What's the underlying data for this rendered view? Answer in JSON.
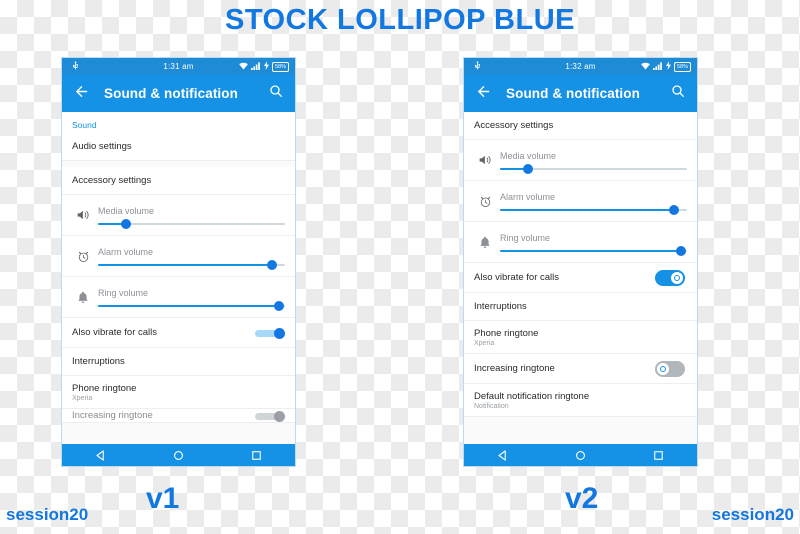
{
  "title": "STOCK LOLLIPOP BLUE",
  "colors": {
    "accent": "#1277e0",
    "appbar": "#1592e6",
    "statusbar": "#1e8bd6",
    "toggle_off": "#b0b6ba"
  },
  "captions": {
    "session_left": "session20",
    "session_right": "session20",
    "v1": "v1",
    "v2": "v2"
  },
  "phones": [
    {
      "id": "v1",
      "statusbar": {
        "time": "1:31 am",
        "battery": "58%",
        "usb_icon": "usb-icon",
        "wifi_icon": "wifi-icon",
        "signal_icon": "signal-icon",
        "charging_icon": "charging-bolt-icon"
      },
      "appbar": {
        "back_icon": "back-arrow-icon",
        "title": "Sound & notification",
        "search_icon": "search-icon"
      },
      "section_label": "Sound",
      "rows": [
        {
          "type": "simple",
          "title": "Audio settings"
        },
        {
          "type": "gap"
        },
        {
          "type": "simple",
          "title": "Accessory settings"
        },
        {
          "type": "slider",
          "label": "Media volume",
          "icon": "speaker-icon",
          "value": 15
        },
        {
          "type": "slider",
          "label": "Alarm volume",
          "icon": "alarm-clock-icon",
          "value": 93
        },
        {
          "type": "slider",
          "label": "Ring volume",
          "icon": "bell-icon",
          "value": 97
        },
        {
          "type": "toggle",
          "title": "Also vibrate for calls",
          "on": true
        },
        {
          "type": "simple",
          "title": "Interruptions"
        },
        {
          "type": "two-line",
          "title": "Phone ringtone",
          "sub": "Xperia"
        },
        {
          "type": "clipped",
          "title": "Increasing ringtone"
        }
      ],
      "navbar": {
        "back": "nav-back-icon",
        "home": "nav-home-icon",
        "recents": "nav-recents-icon"
      }
    },
    {
      "id": "v2",
      "statusbar": {
        "time": "1:32 am",
        "battery": "58%",
        "usb_icon": "usb-icon",
        "wifi_icon": "wifi-icon",
        "signal_icon": "signal-icon",
        "charging_icon": "charging-bolt-icon"
      },
      "appbar": {
        "back_icon": "back-arrow-icon",
        "title": "Sound & notification",
        "search_icon": "search-icon"
      },
      "section_label": "",
      "rows": [
        {
          "type": "simple",
          "title": "Accessory settings"
        },
        {
          "type": "slider",
          "label": "Media volume",
          "icon": "speaker-icon",
          "value": 15
        },
        {
          "type": "slider",
          "label": "Alarm volume",
          "icon": "alarm-clock-icon",
          "value": 93
        },
        {
          "type": "slider",
          "label": "Ring volume",
          "icon": "bell-icon",
          "value": 97
        },
        {
          "type": "toggle",
          "title": "Also vibrate for calls",
          "on": true
        },
        {
          "type": "simple",
          "title": "Interruptions"
        },
        {
          "type": "two-line",
          "title": "Phone ringtone",
          "sub": "Xperia"
        },
        {
          "type": "toggle",
          "title": "Increasing ringtone",
          "on": false
        },
        {
          "type": "two-line",
          "title": "Default notification ringtone",
          "sub": "Notification"
        }
      ],
      "navbar": {
        "back": "nav-back-icon",
        "home": "nav-home-icon",
        "recents": "nav-recents-icon"
      }
    }
  ]
}
